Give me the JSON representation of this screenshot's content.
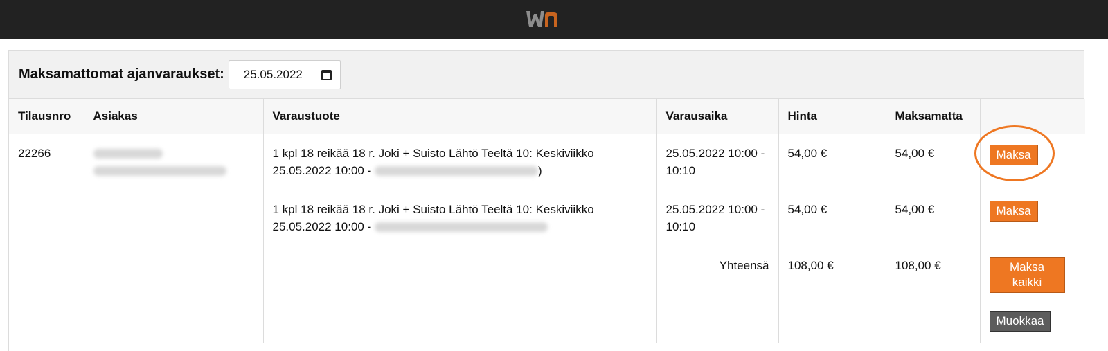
{
  "header": {
    "brand_color": "#ee7722",
    "bar_color": "#222222"
  },
  "panel": {
    "title": "Maksamattomat ajanvaraukset:",
    "date_value": "25.05.2022"
  },
  "table": {
    "columns": [
      "Tilausnro",
      "Asiakas",
      "Varaustuote",
      "Varausaika",
      "Hinta",
      "Maksamatta"
    ],
    "order_number": "22266",
    "rows": [
      {
        "product_line1": "1 kpl 18 reikää 18 r. Joki + Suisto Lähtö Teeltä 10: Keskiviikko",
        "product_line2": "25.05.2022 10:00 -",
        "product_suffix": ")",
        "time_line1": "25.05.2022 10:00 -",
        "time_line2": "10:10",
        "price": "54,00 €",
        "unpaid": "54,00 €",
        "pay_label": "Maksa"
      },
      {
        "product_line1": "1 kpl 18 reikää 18 r. Joki + Suisto Lähtö Teeltä 10: Keskiviikko",
        "product_line2": "25.05.2022 10:00 -",
        "time_line1": "25.05.2022 10:00 -",
        "time_line2": "10:10",
        "price": "54,00 €",
        "unpaid": "54,00 €",
        "pay_label": "Maksa"
      }
    ],
    "total": {
      "label": "Yhteensä",
      "price": "108,00 €",
      "unpaid": "108,00 €",
      "pay_all_line1": "Maksa",
      "pay_all_line2": "kaikki",
      "edit_label": "Muokkaa"
    }
  }
}
